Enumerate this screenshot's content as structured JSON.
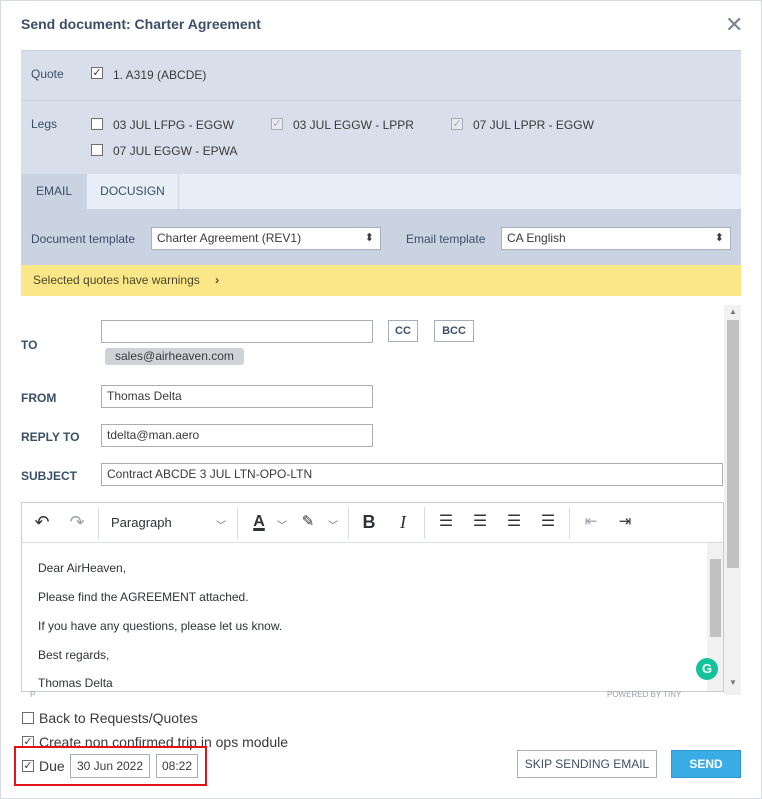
{
  "dialog": {
    "title": "Send document: Charter Agreement",
    "close_icon": "close-icon"
  },
  "quote": {
    "label": "Quote",
    "item": {
      "label": "1. A319 (ABCDE)",
      "checked": true
    }
  },
  "legs": {
    "label": "Legs",
    "items": [
      {
        "label": "03 JUL LFPG - EGGW",
        "checked": false,
        "disabled": false
      },
      {
        "label": "03 JUL EGGW - LPPR",
        "checked": true,
        "disabled": true
      },
      {
        "label": "07 JUL LPPR - EGGW",
        "checked": true,
        "disabled": true
      },
      {
        "label": "07 JUL EGGW - EPWA",
        "checked": false,
        "disabled": false
      }
    ]
  },
  "tabs": [
    {
      "label": "EMAIL",
      "active": true
    },
    {
      "label": "DOCUSIGN",
      "active": false
    }
  ],
  "templates": {
    "document_label": "Document template",
    "document_value": "Charter Agreement (REV1)",
    "email_label": "Email template",
    "email_value": "CA English"
  },
  "warning": {
    "text": "Selected quotes have warnings",
    "chevron": "›"
  },
  "email": {
    "to_label": "TO",
    "to_value": "",
    "cc_label": "CC",
    "bcc_label": "BCC",
    "to_chip": "sales@airheaven.com",
    "from_label": "FROM",
    "from_value": "Thomas Delta",
    "reply_to_label": "REPLY TO",
    "reply_to_value": "tdelta@man.aero",
    "subject_label": "SUBJECT",
    "subject_value": "Contract ABCDE 3 JUL LTN-OPO-LTN"
  },
  "editor": {
    "block_format": "Paragraph",
    "toolbar_icons": [
      "undo-icon",
      "redo-icon",
      "text-color-icon",
      "highlight-icon",
      "bold-icon",
      "italic-icon",
      "align-left-icon",
      "align-center-icon",
      "align-right-icon",
      "align-justify-icon",
      "outdent-icon",
      "indent-icon"
    ],
    "lines": [
      "Dear AirHeaven,",
      "Please find the AGREEMENT attached.",
      "If you have any questions, please let us know.",
      "Best regards,",
      "Thomas Delta"
    ],
    "footer_left": "P",
    "footer_right": "POWERED BY TINY"
  },
  "options": {
    "back_to_requests": {
      "label": "Back to Requests/Quotes",
      "checked": false
    },
    "create_trip": {
      "label": "Create non confirmed trip in ops module",
      "checked": true
    },
    "due": {
      "label": "Due",
      "checked": true,
      "date": "30 Jun 2022",
      "time": "08:22"
    }
  },
  "buttons": {
    "skip": "SKIP SENDING EMAIL",
    "send": "SEND"
  },
  "colors": {
    "accent": "#3aace6",
    "warning_bg": "#fbe688",
    "header_bg": "#d8dfeb",
    "highlight": "#e0141a"
  }
}
